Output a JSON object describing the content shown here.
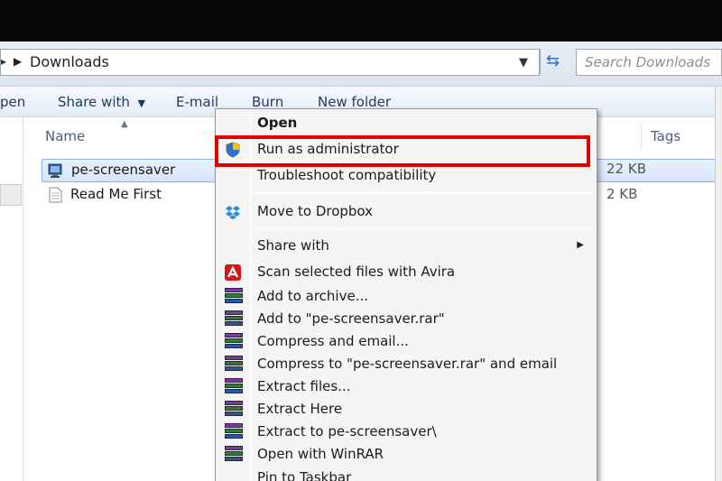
{
  "address_bar": {
    "path": "Downloads",
    "search_placeholder": "Search Downloads"
  },
  "toolbar": {
    "open": "pen",
    "share_with": "Share with",
    "share_arrow": "▼",
    "email": "E-mail",
    "burn": "Burn",
    "new_folder": "New folder"
  },
  "columns": {
    "name": "Name",
    "tags": "Tags"
  },
  "files": [
    {
      "name": "pe-screensaver",
      "size": "22 KB",
      "selected": true
    },
    {
      "name": "Read Me First",
      "size": "2 KB",
      "selected": false
    }
  ],
  "context_menu": {
    "items": [
      {
        "label": "Open"
      },
      {
        "label": "Run as administrator"
      },
      {
        "label": "Troubleshoot compatibility"
      },
      {
        "label": "Move to Dropbox"
      },
      {
        "label": "Share with"
      },
      {
        "label": "Scan selected files with Avira"
      },
      {
        "label": "Add to archive..."
      },
      {
        "label": "Add to \"pe-screensaver.rar\""
      },
      {
        "label": "Compress and email..."
      },
      {
        "label": "Compress to \"pe-screensaver.rar\" and email"
      },
      {
        "label": "Extract files..."
      },
      {
        "label": "Extract Here"
      },
      {
        "label": "Extract to pe-screensaver\\"
      },
      {
        "label": "Open with WinRAR"
      },
      {
        "label": "Pin to Taskbar"
      }
    ]
  },
  "colors": {
    "highlight": "#e00000",
    "toolbar_text": "#1e395b",
    "selection": "#d5e6fb"
  }
}
